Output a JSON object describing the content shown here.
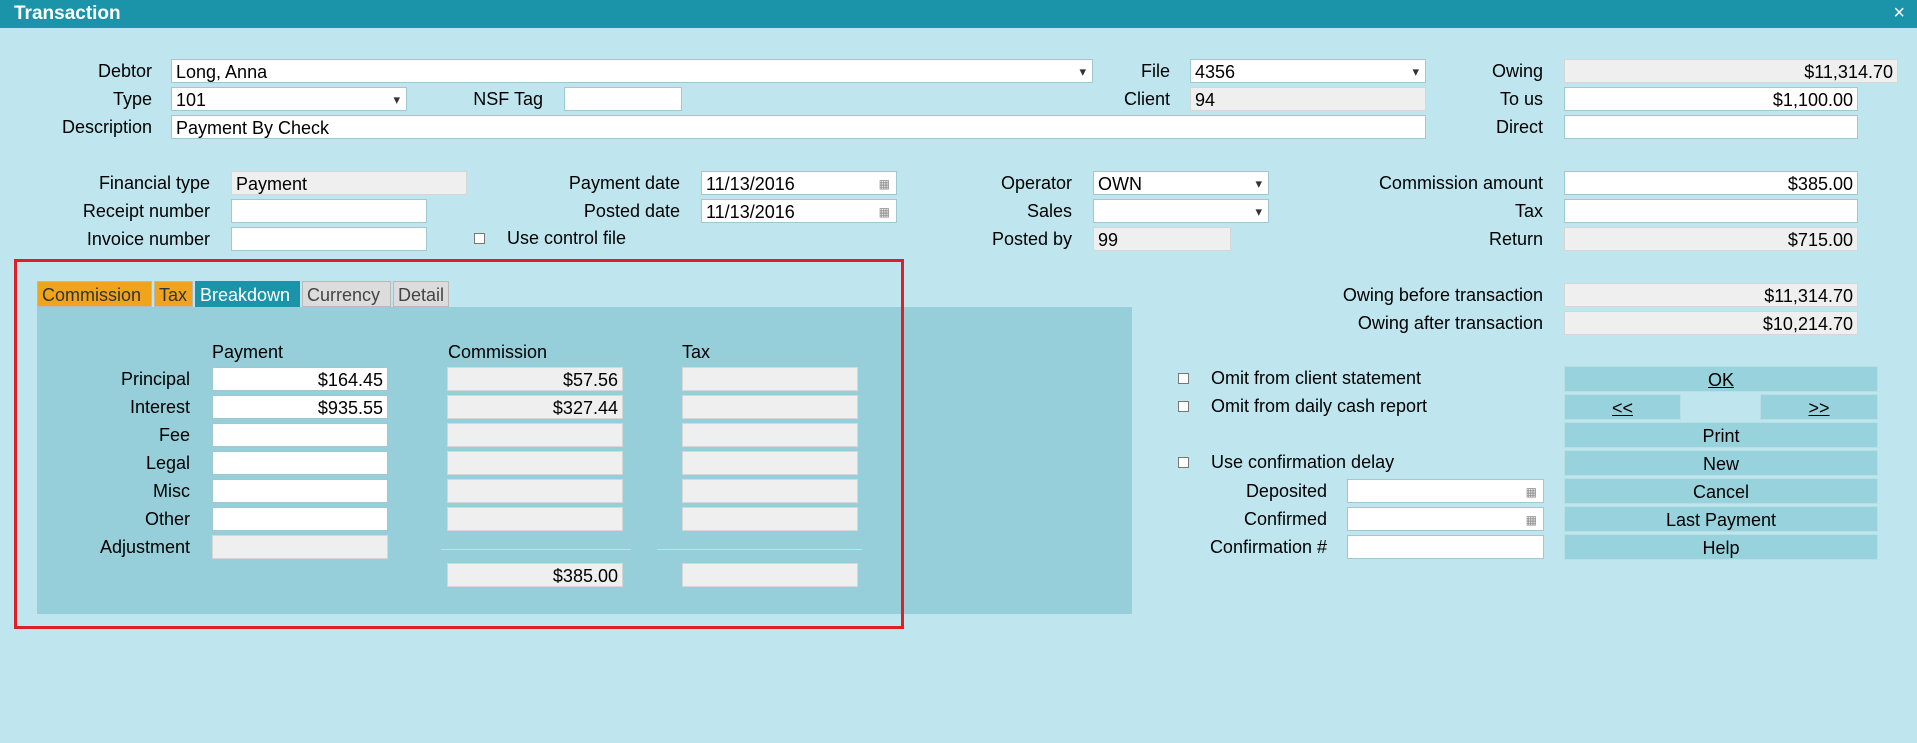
{
  "window": {
    "title": "Transaction",
    "close": "×"
  },
  "row1": {
    "debtor_label": "Debtor",
    "debtor_value": "Long, Anna",
    "file_label": "File",
    "file_value": "4356",
    "owing_label": "Owing",
    "owing_value": "$11,314.70"
  },
  "row2": {
    "type_label": "Type",
    "type_value": "101",
    "nsf_label": "NSF Tag",
    "nsf_value": "",
    "client_label": "Client",
    "client_value": "94",
    "tous_label": "To us",
    "tous_value": "$1,100.00"
  },
  "row3": {
    "desc_label": "Description",
    "desc_value": "Payment By Check",
    "direct_label": "Direct",
    "direct_value": ""
  },
  "fin": {
    "fintype_label": "Financial type",
    "fintype_value": "Payment",
    "receipt_label": "Receipt number",
    "receipt_value": "",
    "invoice_label": "Invoice number",
    "invoice_value": "",
    "paydate_label": "Payment date",
    "paydate_value": "11/13/2016",
    "postdate_label": "Posted date",
    "postdate_value": "11/13/2016",
    "usecontrol_label": "Use control file",
    "operator_label": "Operator",
    "operator_value": "OWN",
    "sales_label": "Sales",
    "sales_value": "",
    "postedby_label": "Posted by",
    "postedby_value": "99",
    "commamt_label": "Commission amount",
    "commamt_value": "$385.00",
    "tax_label": "Tax",
    "tax_value": "",
    "return_label": "Return",
    "return_value": "$715.00"
  },
  "tabs": [
    "Commission",
    "Tax",
    "Breakdown",
    "Currency",
    "Detail"
  ],
  "breakdown": {
    "headers": {
      "payment": "Payment",
      "commission": "Commission",
      "tax": "Tax"
    },
    "rows": [
      {
        "label": "Principal",
        "payment": "$164.45",
        "commission": "$57.56",
        "tax": ""
      },
      {
        "label": "Interest",
        "payment": "$935.55",
        "commission": "$327.44",
        "tax": ""
      },
      {
        "label": "Fee",
        "payment": "",
        "commission": "",
        "tax": ""
      },
      {
        "label": "Legal",
        "payment": "",
        "commission": "",
        "tax": ""
      },
      {
        "label": "Misc",
        "payment": "",
        "commission": "",
        "tax": ""
      },
      {
        "label": "Other",
        "payment": "",
        "commission": "",
        "tax": ""
      },
      {
        "label": "Adjustment",
        "payment": ""
      }
    ],
    "total_commission": "$385.00",
    "total_tax": ""
  },
  "owing_summary": {
    "before_label": "Owing before transaction",
    "before_value": "$11,314.70",
    "after_label": "Owing after transaction",
    "after_value": "$10,214.70"
  },
  "options": {
    "omit_client": "Omit from client statement",
    "omit_daily": "Omit from daily cash report",
    "use_confirm": "Use confirmation delay",
    "deposited_label": "Deposited",
    "deposited_value": "",
    "confirmed_label": "Confirmed",
    "confirmed_value": "",
    "confnum_label": "Confirmation #",
    "confnum_value": ""
  },
  "buttons": {
    "ok": "OK",
    "prev": "<<",
    "next": ">>",
    "print": "Print",
    "new": "New",
    "cancel": "Cancel",
    "last_payment": "Last Payment",
    "help": "Help"
  }
}
